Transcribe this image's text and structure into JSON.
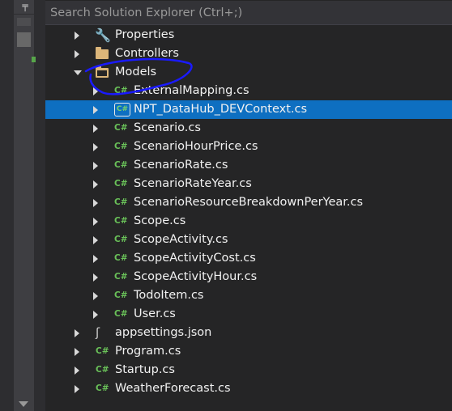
{
  "search": {
    "placeholder": "Search Solution Explorer (Ctrl+;)"
  },
  "tree": {
    "properties": "Properties",
    "controllers": "Controllers",
    "models": "Models",
    "model_files": [
      "ExternalMapping.cs",
      "NPT_DataHub_DEVContext.cs",
      "Scenario.cs",
      "ScenarioHourPrice.cs",
      "ScenarioRate.cs",
      "ScenarioRateYear.cs",
      "ScenarioResourceBreakdownPerYear.cs",
      "Scope.cs",
      "ScopeActivity.cs",
      "ScopeActivityCost.cs",
      "ScopeActivityHour.cs",
      "TodoItem.cs",
      "User.cs"
    ],
    "root_files": [
      "appsettings.json",
      "Program.cs",
      "Startup.cs",
      "WeatherForecast.cs"
    ],
    "cs_glyph": "C#",
    "selected": "NPT_DataHub_DEVContext.cs"
  },
  "colors": {
    "background": "#252526",
    "selection": "#0e6fc1",
    "cs_icon": "#6ac259",
    "folder_icon": "#dcb67a",
    "annotation": "#1a1aff"
  },
  "icons": {
    "pin": "pin-icon",
    "properties": "wrench-icon",
    "folder": "folder-icon",
    "cs_file": "csharp-file-icon",
    "json_file": "json-file-icon"
  }
}
